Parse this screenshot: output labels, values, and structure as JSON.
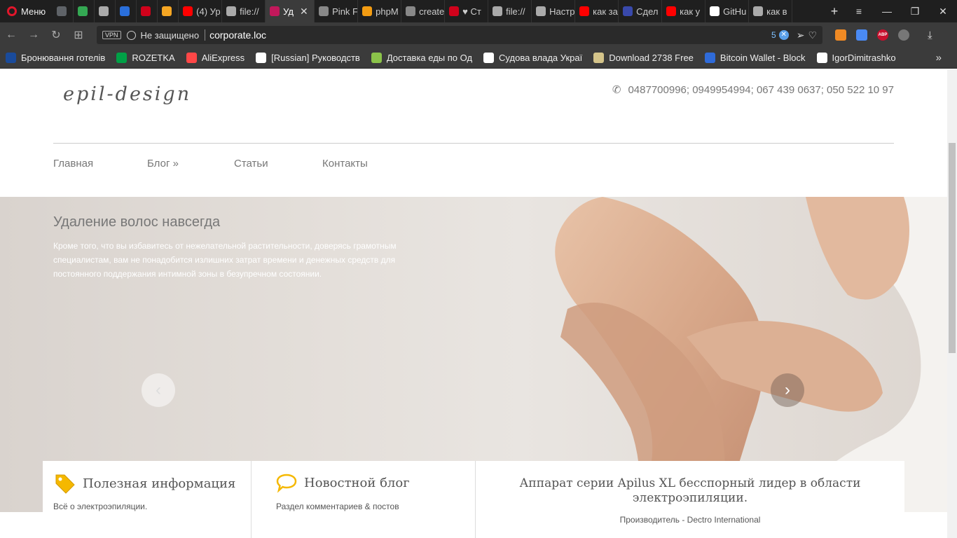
{
  "browser": {
    "menu_label": "Меню",
    "tabs": [
      {
        "label": "",
        "icon": "google-icon",
        "color": "#5f6368"
      },
      {
        "label": "",
        "icon": "sheets-icon",
        "color": "#34a853"
      },
      {
        "label": "",
        "icon": "file-icon",
        "color": "#aaaaaa"
      },
      {
        "label": "",
        "icon": "browser-icon",
        "color": "#2a6fdb"
      },
      {
        "label": "",
        "icon": "h-icon",
        "color": "#d0021b"
      },
      {
        "label": "",
        "icon": "cp-icon",
        "color": "#f5a623"
      },
      {
        "label": "(4) Ур",
        "icon": "youtube-icon",
        "color": "#ff0000"
      },
      {
        "label": "file://",
        "icon": "file-icon",
        "color": "#aaaaaa"
      },
      {
        "label": "Уд",
        "icon": "site-icon",
        "color": "#c2185b",
        "active": true
      },
      {
        "label": "Pink F",
        "icon": "pr-icon",
        "color": "#888888"
      },
      {
        "label": "phpM",
        "icon": "php-icon",
        "color": "#f39c12"
      },
      {
        "label": "create",
        "icon": "pr-icon",
        "color": "#888888"
      },
      {
        "label": "♥ Ст",
        "icon": "e-icon",
        "color": "#d0021b"
      },
      {
        "label": "file://",
        "icon": "file-icon",
        "color": "#aaaaaa"
      },
      {
        "label": "Настр",
        "icon": "gear-icon",
        "color": "#aaaaaa"
      },
      {
        "label": "как за",
        "icon": "yandex-icon",
        "color": "#ff0000"
      },
      {
        "label": "Сдел",
        "icon": "a-icon",
        "color": "#3949ab"
      },
      {
        "label": "как у",
        "icon": "yandex-icon",
        "color": "#ff0000"
      },
      {
        "label": "GitHu",
        "icon": "github-icon",
        "color": "#ffffff"
      },
      {
        "label": "как в",
        "icon": "file-icon",
        "color": "#aaaaaa"
      }
    ],
    "address": {
      "vpn": "VPN",
      "security": "Не защищено",
      "url": "corporate.loc",
      "badge": "5"
    },
    "bookmarks": [
      {
        "label": "Бронювання готелів",
        "icon": "booking-icon",
        "color": "#1a4b9b"
      },
      {
        "label": "ROZETKA",
        "icon": "rozetka-icon",
        "color": "#00a046"
      },
      {
        "label": "AliExpress",
        "icon": "aliexpress-icon",
        "color": "#ff4747"
      },
      {
        "label": "[Russian] Руководств",
        "icon": "github-icon",
        "color": "#ffffff"
      },
      {
        "label": "Доставка еды по Од",
        "icon": "delivery-icon",
        "color": "#8bc34a"
      },
      {
        "label": "Судова влада Украї",
        "icon": "file-icon",
        "color": "#ffffff"
      },
      {
        "label": "Download 2738 Free",
        "icon": "download-icon",
        "color": "#d4c48a"
      },
      {
        "label": "Bitcoin Wallet - Block",
        "icon": "blockchain-icon",
        "color": "#2f6bd9"
      },
      {
        "label": "IgorDimitrashko",
        "icon": "github-icon",
        "color": "#ffffff"
      }
    ]
  },
  "site": {
    "logo": "epil-design",
    "phone": "0487700996; 0949954994; 067 439 0637; 050 522 10 97",
    "nav": [
      "Главная",
      "Блог »",
      "Статьи",
      "Контакты"
    ],
    "hero": {
      "title": "Удаление волос навсегда",
      "text": "Кроме того, что вы избавитесь от нежелательной растительности, доверясь грамотным специалистам, вам не понадобится излишних затрат времени и денежных средств для постоянного поддержания интимной зоны в безупречном состоянии."
    },
    "features": [
      {
        "title": "Полезная информация",
        "sub": "Всё о электроэпиляции.",
        "icon": "tag-icon",
        "color": "#f5b800"
      },
      {
        "title": "Новостной блог",
        "sub": "Раздел комментариев & постов",
        "icon": "speech-bubble-icon",
        "color": "#f5b800"
      }
    ],
    "promo": {
      "title": "Аппарат серии Apilus XL бесспорный лидер в области электроэпиляции.",
      "sub": "Производитель - Dectro International"
    }
  }
}
